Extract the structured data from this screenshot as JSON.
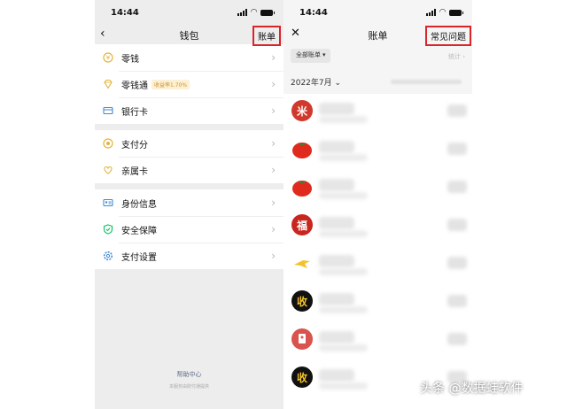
{
  "left_phone": {
    "status": {
      "time": "14:44"
    },
    "nav": {
      "title": "钱包",
      "right_label": "账单"
    },
    "groups": [
      [
        {
          "label": "零钱",
          "icon": "coin-icon"
        },
        {
          "label": "零钱通",
          "icon": "diamond-icon",
          "badge": "收益率1.70%"
        },
        {
          "label": "银行卡",
          "icon": "card-icon"
        }
      ],
      [
        {
          "label": "支付分",
          "icon": "score-icon"
        },
        {
          "label": "亲属卡",
          "icon": "family-icon"
        }
      ],
      [
        {
          "label": "身份信息",
          "icon": "id-icon"
        },
        {
          "label": "安全保障",
          "icon": "shield-icon"
        },
        {
          "label": "支付设置",
          "icon": "gear-icon"
        }
      ]
    ],
    "help_title": "帮助中心",
    "help_sub": "本服务由财付通提供"
  },
  "right_phone": {
    "status": {
      "time": "14:44"
    },
    "nav": {
      "title": "账单",
      "right_label": "常见问题"
    },
    "filter_label": "全部账单 ▾",
    "stats_label": "统计 ›",
    "month_label": "2022年7月 ⌄",
    "transactions": [
      {
        "icon": "mi-logo-icon",
        "glyph": "米",
        "color": "#d0392b"
      },
      {
        "icon": "tomato-icon",
        "glyph": "",
        "color": "#e02a1e"
      },
      {
        "icon": "tomato-icon",
        "glyph": "",
        "color": "#e02a1e"
      },
      {
        "icon": "fu-icon",
        "glyph": "福",
        "color": "#c9261f"
      },
      {
        "icon": "bird-icon",
        "glyph": "",
        "color": "#f3c32a"
      },
      {
        "icon": "receive-icon",
        "glyph": "收",
        "color": "#111111"
      },
      {
        "icon": "red-packet-icon",
        "glyph": "",
        "color": "#d9534f"
      },
      {
        "icon": "receive-icon",
        "glyph": "收",
        "color": "#111111"
      }
    ]
  },
  "watermark": "头条 @数据蛙软件",
  "colors": {
    "highlight_box": "#d9242a",
    "wechat_green": "#07c160"
  }
}
